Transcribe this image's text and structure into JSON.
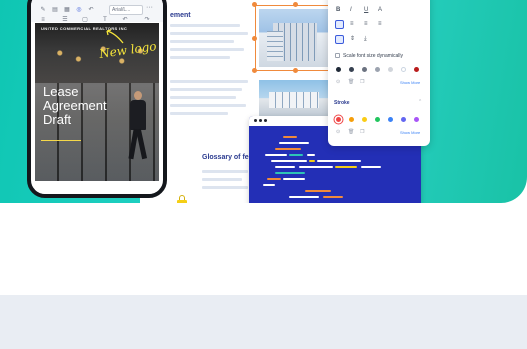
{
  "document": {
    "heading_top": "ement",
    "heading_glossary": "Glossary of ferr"
  },
  "phone": {
    "toolbar_font_select": "Arial/L...",
    "toolbar_more": "···",
    "poster_header": "UNITED COMMERCIAL REALTORS INC",
    "poster_title_line1": "Lease",
    "poster_title_line2": "Agreement",
    "poster_title_line3": "Draft",
    "annotation_text": "New logo"
  },
  "panel": {
    "scale_label": "Scale font size dynamically",
    "show_more_1": "Show More",
    "stroke_label": "Stroke",
    "show_more_2": "Show More",
    "fill_colors": [
      "#1f2937",
      "#374151",
      "#6b7280",
      "#9ca3af",
      "#d1d5db",
      "#ffffff",
      "#b91c1c"
    ],
    "stroke_colors": [
      "#ef4444",
      "#f59e0b",
      "#facc15",
      "#22c55e",
      "#3b82f6",
      "#6366f1",
      "#a855f7"
    ]
  },
  "colors": {
    "hero_teal": "#1fd0c2",
    "accent_orange": "#f08a3c",
    "code_bg": "#232fb6",
    "bottom_band": "#e9edf3"
  }
}
